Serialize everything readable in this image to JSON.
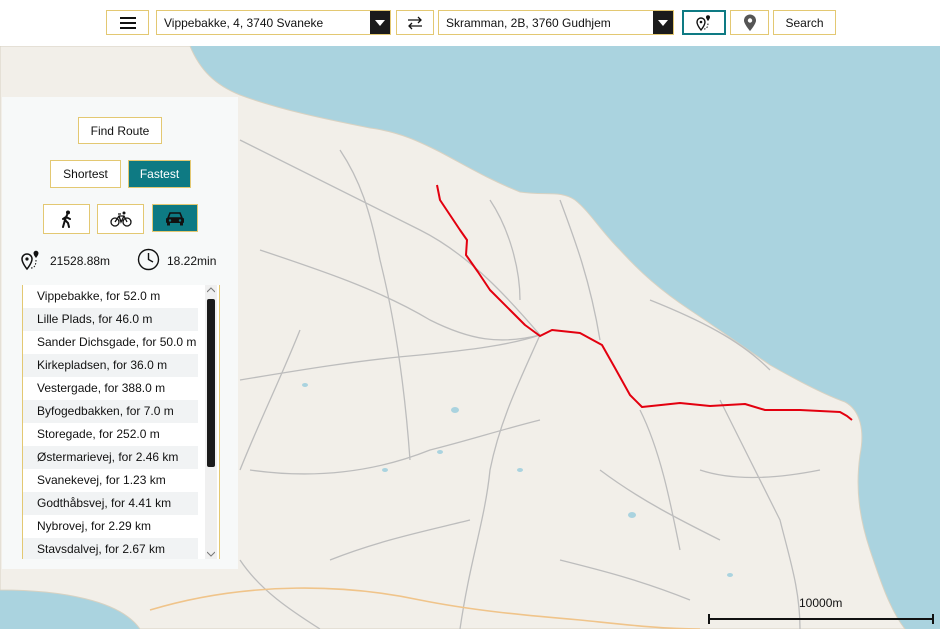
{
  "toolbar": {
    "from_value": "Vippebakke, 4, 3740 Svaneke",
    "to_value": "Skramman, 2B, 3760 Gudhjem",
    "search_label": "Search",
    "menu_icon": "hamburger-icon",
    "swap_icon": "swap-arrows-icon",
    "route_icon": "route-pin-icon",
    "pin_icon": "map-pin-icon"
  },
  "panel": {
    "find_route_label": "Find Route",
    "shortest_label": "Shortest",
    "fastest_label": "Fastest",
    "selected_mode": "car",
    "distance": "21528.88m",
    "time": "18.22min",
    "directions": [
      "Vippebakke, for 52.0 m",
      "Lille Plads, for 46.0 m",
      "Sander Dichsgade, for 50.0 m",
      "Kirkepladsen, for 36.0 m",
      "Vestergade, for 388.0 m",
      "Byfogedbakken, for 7.0 m",
      "Storegade, for 252.0 m",
      "Østermarievej, for 2.46 km",
      "Svanekevej, for 1.23 km",
      "Godthåbsvej, for 4.41 km",
      "Nybrovej, for 2.29 km",
      "Stavsdalvej, for 2.67 km"
    ]
  },
  "map": {
    "scale_label": "10000m",
    "colors": {
      "water": "#aad3df",
      "land": "#f2efe9",
      "route": "#e3000f",
      "accent": "#0e7a83",
      "border": "#e3c872"
    }
  }
}
